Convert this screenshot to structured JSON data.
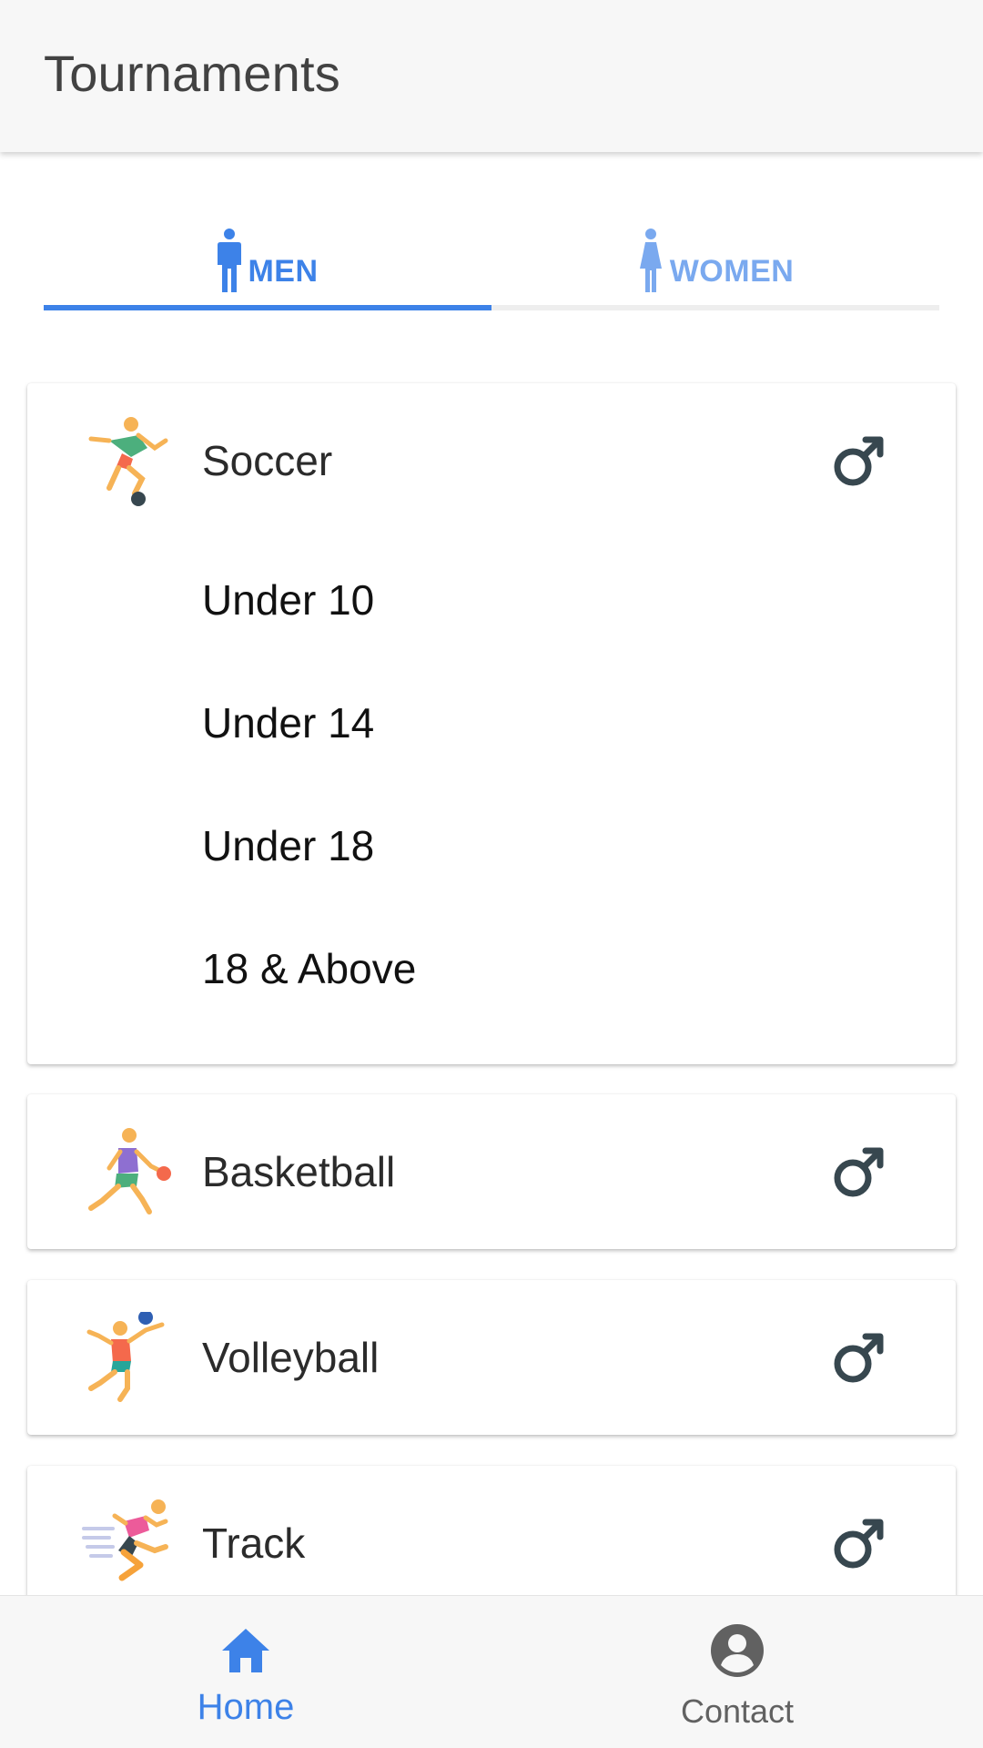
{
  "header": {
    "title": "Tournaments"
  },
  "tabs": [
    {
      "label": "MEN",
      "icon": "male-person-icon",
      "selected": true
    },
    {
      "label": "WOMEN",
      "icon": "female-person-icon",
      "selected": false
    }
  ],
  "colors": {
    "accent": "#3d82e8",
    "accent_light": "#7aa9ef",
    "text": "#2b2b2b",
    "icon_gray": "#37474f"
  },
  "sports": [
    {
      "name": "Soccer",
      "icon": "soccer-player-icon",
      "gender_icon": "male-symbol-icon",
      "expanded": true,
      "categories": [
        "Under 10",
        "Under 14",
        "Under 18",
        "18 & Above"
      ]
    },
    {
      "name": "Basketball",
      "icon": "basketball-player-icon",
      "gender_icon": "male-symbol-icon",
      "expanded": false
    },
    {
      "name": "Volleyball",
      "icon": "volleyball-player-icon",
      "gender_icon": "male-symbol-icon",
      "expanded": false
    },
    {
      "name": "Track",
      "icon": "runner-icon",
      "gender_icon": "male-symbol-icon",
      "expanded": false
    }
  ],
  "bottom_nav": [
    {
      "label": "Home",
      "icon": "home-icon",
      "active": true
    },
    {
      "label": "Contact",
      "icon": "account-circle-icon",
      "active": false
    }
  ]
}
